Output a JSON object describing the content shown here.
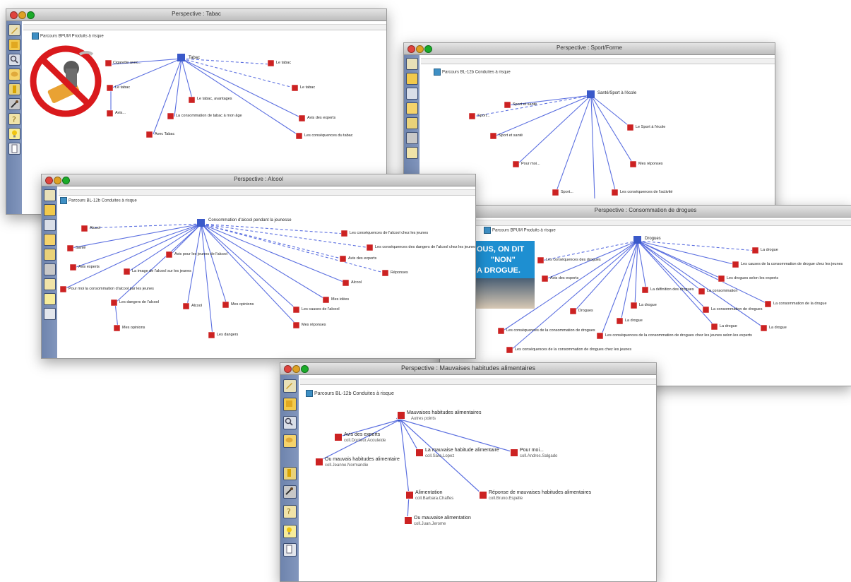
{
  "windows": {
    "tabac": {
      "title": "Perspective : Tabac",
      "root_label": "Parcours BPUM Produits à risque"
    },
    "alimentation": {
      "title": "Perspective : Mauvaises habitudes alimentaires",
      "root_label": "Parcours BL-12b Conduites à risque"
    },
    "alcool": {
      "title": "Perspective : Alcool",
      "root_label": "Parcours BL-12b Conduites à risque"
    },
    "sport": {
      "title": "Perspective : Sport/Forme",
      "root_label": "Parcours BL-12b Conduites à risque"
    },
    "drogues": {
      "title": "Perspective : Consommation de drogues",
      "root_label": "Parcours BPUM Produits à risque"
    }
  },
  "poster": {
    "line1": "OUS, ON DIT",
    "line2": "\"NON\"",
    "line3": "A DROGUE."
  },
  "food_map": {
    "center": {
      "title": "Mauvaises habitudes alimentaires",
      "sub": "Autres points"
    },
    "nodes": [
      {
        "title": "Avis des experts",
        "sub": "coll.Docteur.Acouleide"
      },
      {
        "title": "La mauvaise habitude alimentaire",
        "sub": "coll.Sara.Lopez"
      },
      {
        "title": "Pour moi...",
        "sub": "coll.Andres.Salgado"
      },
      {
        "title": "Ou mauvais habitudes alimentaire",
        "sub": "coll.Jeanne.Normandie"
      },
      {
        "title": "Alimentation",
        "sub": "coll.Barbara.Chaffes"
      },
      {
        "title": "Réponse de mauvaises habitudes alimentaires",
        "sub": "coll.Bruno.Espelle"
      },
      {
        "title": "Ou mauvaise alimentation",
        "sub": "coll.Juan.Jerome"
      }
    ]
  },
  "tool_icons": [
    "pencil-icon",
    "note-icon",
    "magnifier-icon",
    "speech-bubble-icon",
    "book-icon",
    "brush-icon",
    "help-icon",
    "bulb-icon",
    "document-icon"
  ]
}
